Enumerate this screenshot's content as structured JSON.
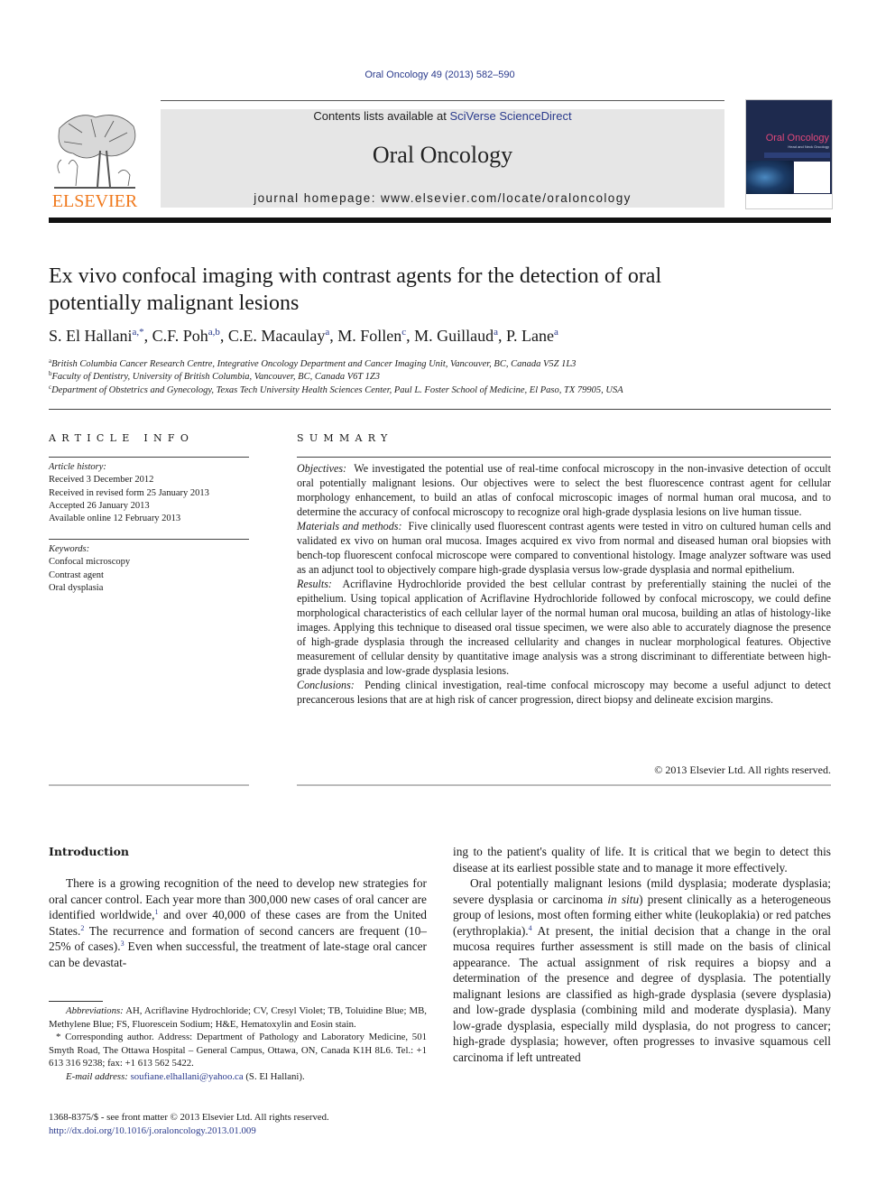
{
  "header": {
    "citation": "Oral Oncology 49 (2013) 582–590",
    "contents_prefix": "Contents lists available at ",
    "contents_link": "SciVerse ScienceDirect",
    "journal_title": "Oral Oncology",
    "homepage_prefix": "journal homepage: ",
    "homepage_url": "www.elsevier.com/locate/oraloncology",
    "publisher_logo_text": "ELSEVIER",
    "cover_title": "Oral Oncology",
    "cover_subtitle": "Head and Neck Oncology",
    "brand_color": "#f07a1e",
    "link_color": "#2a3a8c"
  },
  "article": {
    "title_line1": "Ex vivo confocal imaging with contrast agents for the detection of oral",
    "title_line2": "potentially malignant lesions",
    "authors": [
      {
        "name": "S. El Hallani",
        "sup": "a,*"
      },
      {
        "name": "C.F. Poh",
        "sup": "a,b"
      },
      {
        "name": "C.E. Macaulay",
        "sup": "a"
      },
      {
        "name": "M. Follen",
        "sup": "c"
      },
      {
        "name": "M. Guillaud",
        "sup": "a"
      },
      {
        "name": "P. Lane",
        "sup": "a"
      }
    ],
    "affiliations": [
      {
        "key": "a",
        "text": "British Columbia Cancer Research Centre, Integrative Oncology Department and Cancer Imaging Unit, Vancouver, BC, Canada V5Z 1L3"
      },
      {
        "key": "b",
        "text": "Faculty of Dentistry, University of British Columbia, Vancouver, BC, Canada V6T 1Z3"
      },
      {
        "key": "c",
        "text": "Department of Obstetrics and Gynecology, Texas Tech University Health Sciences Center, Paul L. Foster School of Medicine, El Paso, TX 79905, USA"
      }
    ]
  },
  "article_info": {
    "heading": "ARTICLE INFO",
    "history_label": "Article history:",
    "history": [
      "Received 3 December 2012",
      "Received in revised form 25 January 2013",
      "Accepted 26 January 2013",
      "Available online 12 February 2013"
    ],
    "keywords_label": "Keywords:",
    "keywords": [
      "Confocal microscopy",
      "Contrast agent",
      "Oral dysplasia"
    ]
  },
  "summary": {
    "heading": "SUMMARY",
    "sections": [
      {
        "label": "Objectives:",
        "text": "We investigated the potential use of real-time confocal microscopy in the non-invasive detection of occult oral potentially malignant lesions. Our objectives were to select the best fluorescence contrast agent for cellular morphology enhancement, to build an atlas of confocal microscopic images of normal human oral mucosa, and to determine the accuracy of confocal microscopy to recognize oral high-grade dysplasia lesions on live human tissue."
      },
      {
        "label": "Materials and methods:",
        "text": "Five clinically used fluorescent contrast agents were tested in vitro on cultured human cells and validated ex vivo on human oral mucosa. Images acquired ex vivo from normal and diseased human oral biopsies with bench-top fluorescent confocal microscope were compared to conventional histology. Image analyzer software was used as an adjunct tool to objectively compare high-grade dysplasia versus low-grade dysplasia and normal epithelium."
      },
      {
        "label": "Results:",
        "text": "Acriflavine Hydrochloride provided the best cellular contrast by preferentially staining the nuclei of the epithelium. Using topical application of Acriflavine Hydrochloride followed by confocal microscopy, we could define morphological characteristics of each cellular layer of the normal human oral mucosa, building an atlas of histology-like images. Applying this technique to diseased oral tissue specimen, we were also able to accurately diagnose the presence of high-grade dysplasia through the increased cellularity and changes in nuclear morphological features. Objective measurement of cellular density by quantitative image analysis was a strong discriminant to differentiate between high-grade dysplasia and low-grade dysplasia lesions."
      },
      {
        "label": "Conclusions:",
        "text": "Pending clinical investigation, real-time confocal microscopy may become a useful adjunct to detect precancerous lesions that are at high risk of cancer progression, direct biopsy and delineate excision margins."
      }
    ],
    "copyright": "© 2013 Elsevier Ltd. All rights reserved."
  },
  "body": {
    "intro_heading": "Introduction",
    "left_p1_a": "There is a growing recognition of the need to develop new strategies for oral cancer control. Each year more than 300,000 new cases of oral cancer are identified worldwide,",
    "ref1": "1",
    "left_p1_b": " and over 40,000 of these cases are from the United States.",
    "ref2": "2",
    "left_p1_c": " The recurrence and formation of second cancers are frequent (10–25% of cases).",
    "ref3": "3",
    "left_p1_d": " Even when successful, the treatment of late-stage oral cancer can be devastat-",
    "right_p1": "ing to the patient's quality of life. It is critical that we begin to detect this disease at its earliest possible state and to manage it more effectively.",
    "right_p2_a": "Oral potentially malignant lesions (mild dysplasia; moderate dysplasia; severe dysplasia or carcinoma ",
    "right_p2_italic": "in situ",
    "right_p2_b": ") present clinically as a heterogeneous group of lesions, most often forming either white (leukoplakia) or red patches (erythroplakia).",
    "ref4": "4",
    "right_p2_c": " At present, the initial decision that a change in the oral mucosa requires further assessment is still made on the basis of clinical appearance. The actual assignment of risk requires a biopsy and a determination of the presence and degree of dysplasia. The potentially malignant lesions are classified as high-grade dysplasia (severe dysplasia) and low-grade dysplasia (combining mild and moderate dysplasia). Many low-grade dysplasia, especially mild dysplasia, do not progress to cancer; high-grade dysplasia; however, often progresses to invasive squamous cell carcinoma if left untreated"
  },
  "footnotes": {
    "abbrev_label": "Abbreviations:",
    "abbrev_text": "AH, Acriflavine Hydrochloride; CV, Cresyl Violet; TB, Toluidine Blue; MB, Methylene Blue; FS, Fluorescein Sodium; H&E, Hematoxylin and Eosin stain.",
    "corresponding": "* Corresponding author. Address: Department of Pathology and Laboratory Medicine, 501 Smyth Road, The Ottawa Hospital – General Campus, Ottawa, ON, Canada K1H 8L6. Tel.: +1 613 316 9238; fax: +1 613 562 5422.",
    "email_label": "E-mail address:",
    "email": "soufiane.elhallani@yahoo.ca",
    "email_suffix": " (S. El Hallani).",
    "issn": "1368-8375/$ - see front matter © 2013 Elsevier Ltd. All rights reserved.",
    "doi": "http://dx.doi.org/10.1016/j.oraloncology.2013.01.009"
  }
}
